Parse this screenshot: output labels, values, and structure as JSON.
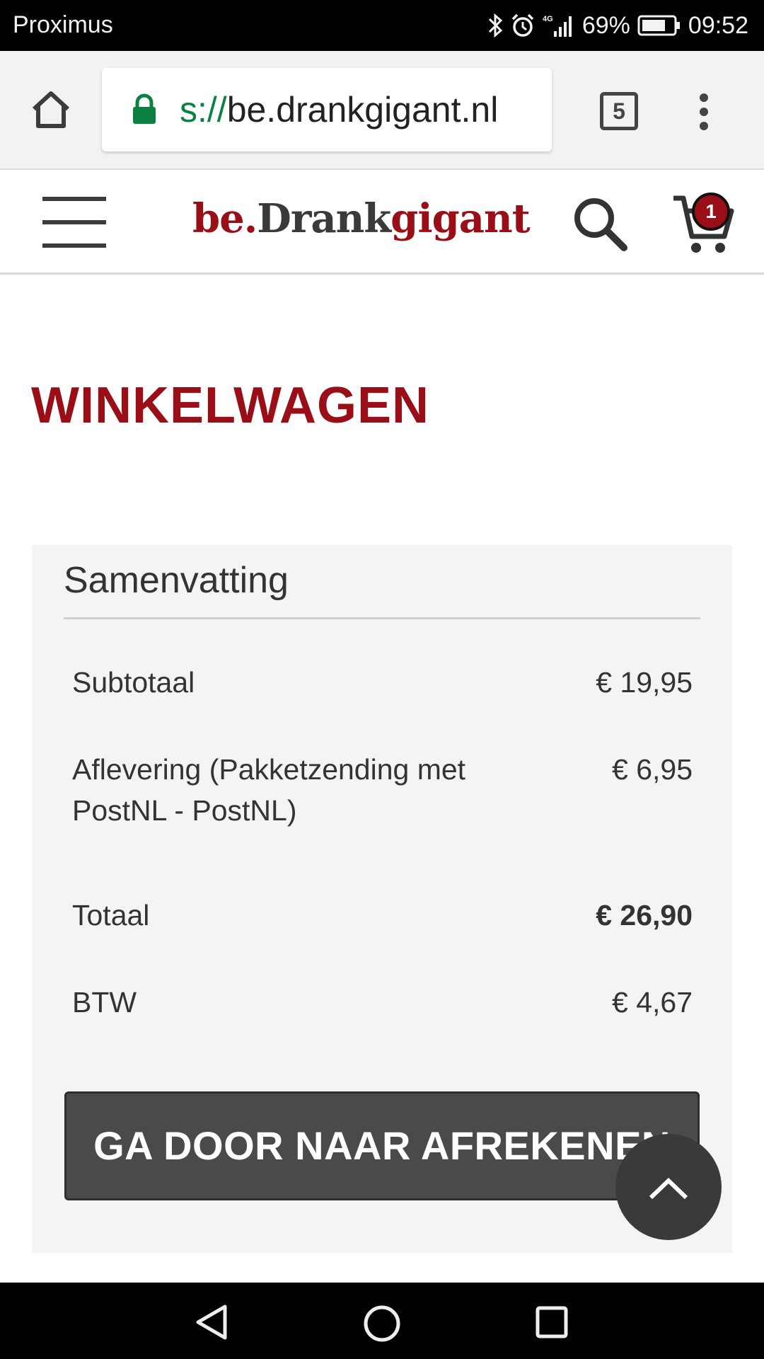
{
  "status_bar": {
    "carrier": "Proximus",
    "network": "4G",
    "battery": "69%",
    "time": "09:52",
    "icons": [
      "bluetooth-icon",
      "alarm-icon",
      "signal-icon",
      "battery-icon"
    ]
  },
  "browser": {
    "url_scheme": "s://",
    "url_host": "be.drankgigant.nl",
    "tab_count": "5",
    "icons": [
      "home-icon",
      "lock-icon",
      "tabs-icon",
      "overflow-menu-icon"
    ]
  },
  "site": {
    "logo_part1": "be.",
    "logo_part2": "Drank",
    "logo_part3": "gigant",
    "cart_count": "1",
    "icons": [
      "hamburger-menu-icon",
      "search-icon",
      "cart-icon"
    ]
  },
  "page": {
    "title": "WINKELWAGEN"
  },
  "summary": {
    "heading": "Samenvatting",
    "rows": [
      {
        "label": "Subtotaal",
        "value": "€ 19,95"
      },
      {
        "label": "Aflevering (Pakketzending met PostNL - PostNL)",
        "value": "€ 6,95"
      },
      {
        "label": "Totaal",
        "value": "€ 26,90"
      },
      {
        "label": "BTW",
        "value": "€ 4,67"
      }
    ],
    "checkout_label": "GA DOOR NAAR AFREKENEN"
  },
  "colors": {
    "brand_red": "#9a0f17",
    "dark_text": "#333333",
    "panel_bg": "#f4f4f4",
    "button_bg": "#4a4a4a"
  }
}
